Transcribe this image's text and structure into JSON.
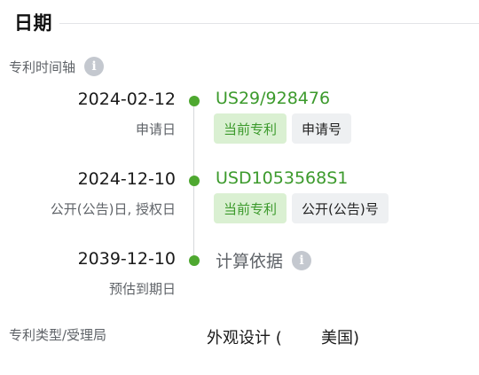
{
  "section": {
    "title": "日期"
  },
  "timeline": {
    "label": "专利时间轴",
    "info_icon_glyph": "i",
    "current_tag": "当前专利",
    "events": [
      {
        "date": "2024-02-12",
        "sublabel": "申请日",
        "link": "US29/928476",
        "tag": "申请号"
      },
      {
        "date": "2024-12-10",
        "sublabel": "公开(公告)日, 授权日",
        "link": "USD1053568S1",
        "tag": "公开(公告)号"
      },
      {
        "date": "2039-12-10",
        "sublabel": "预估到期日",
        "basis": "计算依据"
      }
    ]
  },
  "patent_type": {
    "label": "专利类型/受理局",
    "type_value": "外观设计 (",
    "office_value": "美国)"
  },
  "colors": {
    "accent_green": "#3c9a2c",
    "dot_green": "#4ea830",
    "tag_green_bg": "#daf0d2",
    "tag_gray_bg": "#eef0f2",
    "muted_text": "#5f6368"
  },
  "icons": [
    "info-icon",
    "timeline-dot"
  ]
}
